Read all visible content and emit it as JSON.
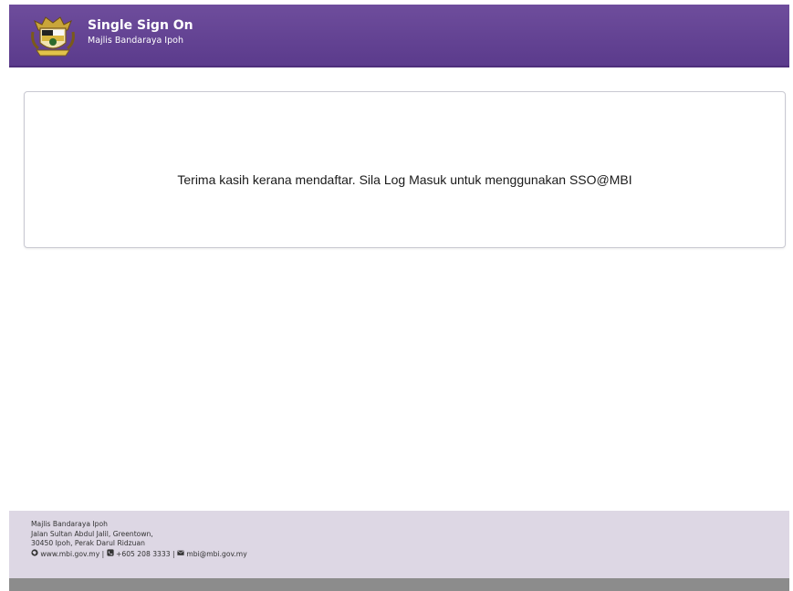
{
  "header": {
    "title": "Single Sign On",
    "subtitle": "Majlis Bandaraya Ipoh"
  },
  "message": {
    "text": "Terima kasih kerana mendaftar. Sila Log Masuk untuk menggunakan SSO@MBI"
  },
  "footer": {
    "org": "Majlis Bandaraya Ipoh",
    "address1": "Jalan Sultan Abdul Jalil, Greentown,",
    "address2": "30450 Ipoh, Perak Darul Ridzuan",
    "website": "www.mbi.gov.my",
    "separator": "|",
    "phone": "+605 208 3333",
    "email": "mbi@mbi.gov.my"
  },
  "colors": {
    "header": "#5b3b8c",
    "footer": "#ddd7e4"
  },
  "icons": [
    "crest-logo",
    "globe-icon",
    "phone-icon",
    "envelope-icon"
  ]
}
